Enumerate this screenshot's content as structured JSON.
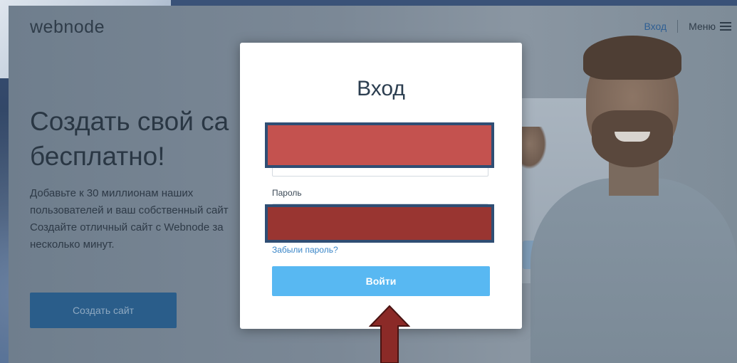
{
  "site": {
    "logo": "webnode",
    "nav": {
      "login": "Вход",
      "menu": "Меню"
    },
    "hero": {
      "title_line1": "Создать свой са",
      "title_line2": "бесплатно!",
      "text_lines": [
        "Добавьте к 30 миллионам наших",
        "пользователей и ваш собственный сайт",
        "Создайте отличный сайт с Webnode за",
        "несколько минут."
      ],
      "button": "Создать сайт"
    }
  },
  "modal": {
    "title": "Вход",
    "email_value": "",
    "password_label": "Пароль",
    "password_value": "",
    "forgot_link": "Забыли пароль?",
    "submit": "Войти"
  },
  "colors": {
    "accent_button": "#58b8f2",
    "link": "#3a86c8",
    "redact_top": "#c4524f",
    "redact_bottom": "#993531",
    "arrow": "#8b2a27"
  },
  "icons": {
    "menu": "hamburger-icon",
    "annotation": "up-arrow-icon"
  }
}
